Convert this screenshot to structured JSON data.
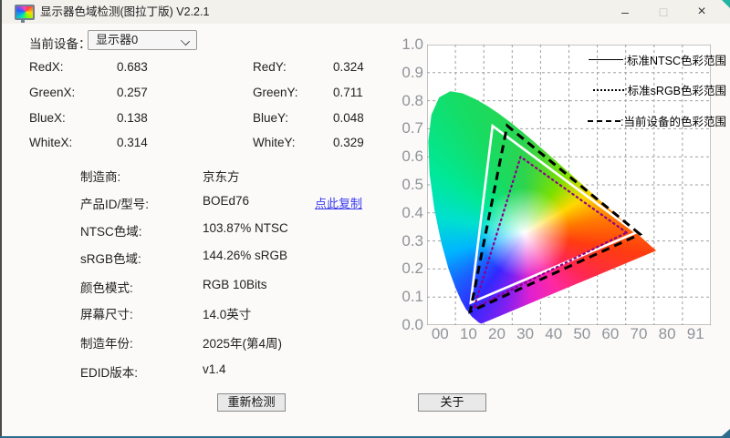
{
  "window": {
    "title": "显示器色域检测(图拉丁版) V2.2.1",
    "icon": "monitor-color-icon",
    "controls": {
      "minimize": "–",
      "maximize": "□",
      "close": "×"
    }
  },
  "device_selector": {
    "label": "当前设备：",
    "value": "显示器0"
  },
  "coordinates": {
    "rows": [
      {
        "label1": "RedX:",
        "value1": "0.683",
        "label2": "RedY:",
        "value2": "0.324"
      },
      {
        "label1": "GreenX:",
        "value1": "0.257",
        "label2": "GreenY:",
        "value2": "0.711"
      },
      {
        "label1": "BlueX:",
        "value1": "0.138",
        "label2": "BlueY:",
        "value2": "0.048"
      },
      {
        "label1": "WhiteX:",
        "value1": "0.314",
        "label2": "WhiteY:",
        "value2": "0.329"
      }
    ]
  },
  "info": {
    "copy_link": "点此复制",
    "rows": [
      {
        "label": "制造商:",
        "value": "京东方"
      },
      {
        "label": "产品ID/型号:",
        "value": "BOEd76",
        "has_link": true
      },
      {
        "label": "NTSC色域:",
        "value": "103.87% NTSC"
      },
      {
        "label": "sRGB色域:",
        "value": "144.26% sRGB"
      },
      {
        "label": "颜色模式:",
        "value": "RGB 10Bits"
      },
      {
        "label": "屏幕尺寸:",
        "value": "14.0英寸"
      },
      {
        "label": "制造年份:",
        "value": "2025年(第4周)"
      },
      {
        "label": "EDID版本:",
        "value": "v1.4"
      }
    ]
  },
  "buttons": {
    "redetect": "重新检测",
    "about": "关于"
  },
  "chart_data": {
    "type": "area",
    "subtype": "cie-1931-chromaticity-diagram",
    "x_axis": {
      "range": [
        0,
        0.91
      ],
      "tick_labels": [
        "00",
        "10",
        "20",
        "30",
        "40",
        "50",
        "60",
        "70",
        "80",
        "91"
      ],
      "tick_values": [
        0.0,
        0.1,
        0.2,
        0.3,
        0.4,
        0.5,
        0.6,
        0.7,
        0.8,
        0.91
      ]
    },
    "y_axis": {
      "range": [
        0,
        1.0
      ],
      "tick_labels": [
        "1.0",
        "0.9",
        "0.8",
        "0.7",
        "0.6",
        "0.5",
        "0.4",
        "0.3",
        "0.2",
        "0.1",
        "0.0"
      ]
    },
    "grid": true,
    "legend_position": "top-right",
    "legend": [
      {
        "style": "solid",
        "label": ":标准NTSC色彩范围"
      },
      {
        "style": "dotted",
        "label": ":标准sRGB色彩范围"
      },
      {
        "style": "dashed",
        "label": ":当前设备的色彩范围"
      }
    ],
    "gamut_triangles": [
      {
        "name": "NTSC",
        "style": "solid",
        "stroke": "#ffffff",
        "points": [
          [
            0.67,
            0.33
          ],
          [
            0.21,
            0.71
          ],
          [
            0.14,
            0.08
          ]
        ]
      },
      {
        "name": "sRGB",
        "style": "dotted",
        "stroke": "#8b008b",
        "points": [
          [
            0.64,
            0.33
          ],
          [
            0.3,
            0.6
          ],
          [
            0.15,
            0.06
          ]
        ]
      },
      {
        "name": "device",
        "style": "dashed",
        "stroke": "#000000",
        "points": [
          [
            0.683,
            0.324
          ],
          [
            0.257,
            0.711
          ],
          [
            0.138,
            0.048
          ]
        ]
      }
    ],
    "white_point": [
      0.314,
      0.329
    ],
    "spectral_locus": [
      [
        0.1741,
        0.005
      ],
      [
        0.166,
        0.009
      ],
      [
        0.1566,
        0.0177
      ],
      [
        0.144,
        0.0297
      ],
      [
        0.1241,
        0.0578
      ],
      [
        0.1096,
        0.0868
      ],
      [
        0.0913,
        0.1327
      ],
      [
        0.0687,
        0.2007
      ],
      [
        0.0454,
        0.295
      ],
      [
        0.0235,
        0.4127
      ],
      [
        0.0082,
        0.5384
      ],
      [
        0.0039,
        0.6548
      ],
      [
        0.0139,
        0.7502
      ],
      [
        0.0389,
        0.812
      ],
      [
        0.0743,
        0.8338
      ],
      [
        0.1142,
        0.8262
      ],
      [
        0.1547,
        0.8059
      ],
      [
        0.1929,
        0.7816
      ],
      [
        0.2296,
        0.7543
      ],
      [
        0.2658,
        0.7243
      ],
      [
        0.3016,
        0.6923
      ],
      [
        0.3373,
        0.6589
      ],
      [
        0.3731,
        0.6245
      ],
      [
        0.4087,
        0.5896
      ],
      [
        0.4441,
        0.5547
      ],
      [
        0.4788,
        0.5202
      ],
      [
        0.5125,
        0.4866
      ],
      [
        0.5448,
        0.4544
      ],
      [
        0.5752,
        0.4242
      ],
      [
        0.6029,
        0.3965
      ],
      [
        0.627,
        0.3725
      ],
      [
        0.6482,
        0.3514
      ],
      [
        0.6658,
        0.334
      ],
      [
        0.6915,
        0.3083
      ],
      [
        0.714,
        0.2859
      ],
      [
        0.7347,
        0.2653
      ]
    ],
    "colors": {
      "grid": "#a0a0a0",
      "border": "#8a8a8a",
      "tick_text": "#8f939a"
    }
  }
}
